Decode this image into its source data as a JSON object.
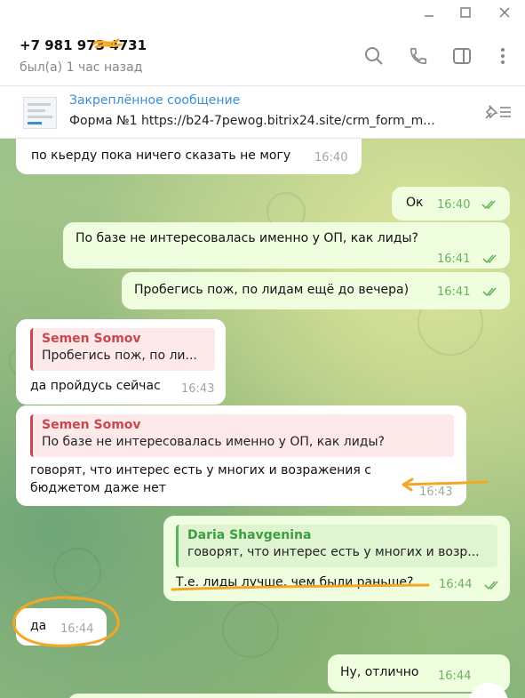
{
  "header": {
    "contact_name": "+7 981 973 4731",
    "status": "был(а) 1 час назад"
  },
  "pinned": {
    "title": "Закреплённое сообщение",
    "text": "Форма №1 https://b24-7pewog.bitrix24.site/crm_form_m..."
  },
  "messages": [
    {
      "dir": "in",
      "text": "по кьерду пока ничего сказать не могу",
      "time": "16:40"
    },
    {
      "dir": "out",
      "text": "Ок",
      "time": "16:40"
    },
    {
      "dir": "out",
      "text": "По базе не интересовалась именно у ОП, как лиды?",
      "time": "16:41"
    },
    {
      "dir": "out",
      "text": "Пробегись пож, по лидам ещё до вечера)",
      "time": "16:41"
    },
    {
      "dir": "in",
      "reply_name": "Semen Somov",
      "reply_text": "Пробегись пож, по ли...",
      "text": "да пройдусь сейчас",
      "time": "16:43"
    },
    {
      "dir": "in",
      "reply_name": "Semen Somov",
      "reply_text": "По базе не интересовалась именно у ОП, как лиды?",
      "text_line1": "говорят, что интерес есть у многих и возражения с",
      "text_line2": "бюджетом даже нет",
      "time": "16:43"
    },
    {
      "dir": "out",
      "reply_name": "Daria Shavgenina",
      "reply_text": "говорят, что интерес есть у многих и возр...",
      "text": "Т.е. лиды лучше, чем были раньше?",
      "time": "16:44"
    },
    {
      "dir": "in",
      "text": "да",
      "time": "16:44"
    },
    {
      "dir": "out",
      "text": "Ну, отлично",
      "time": "16:44"
    }
  ],
  "colors": {
    "accent": "#3a8fd6",
    "reply_red": "#c9474c",
    "reply_green": "#3e9e3e",
    "annotation": "#f5a623"
  }
}
